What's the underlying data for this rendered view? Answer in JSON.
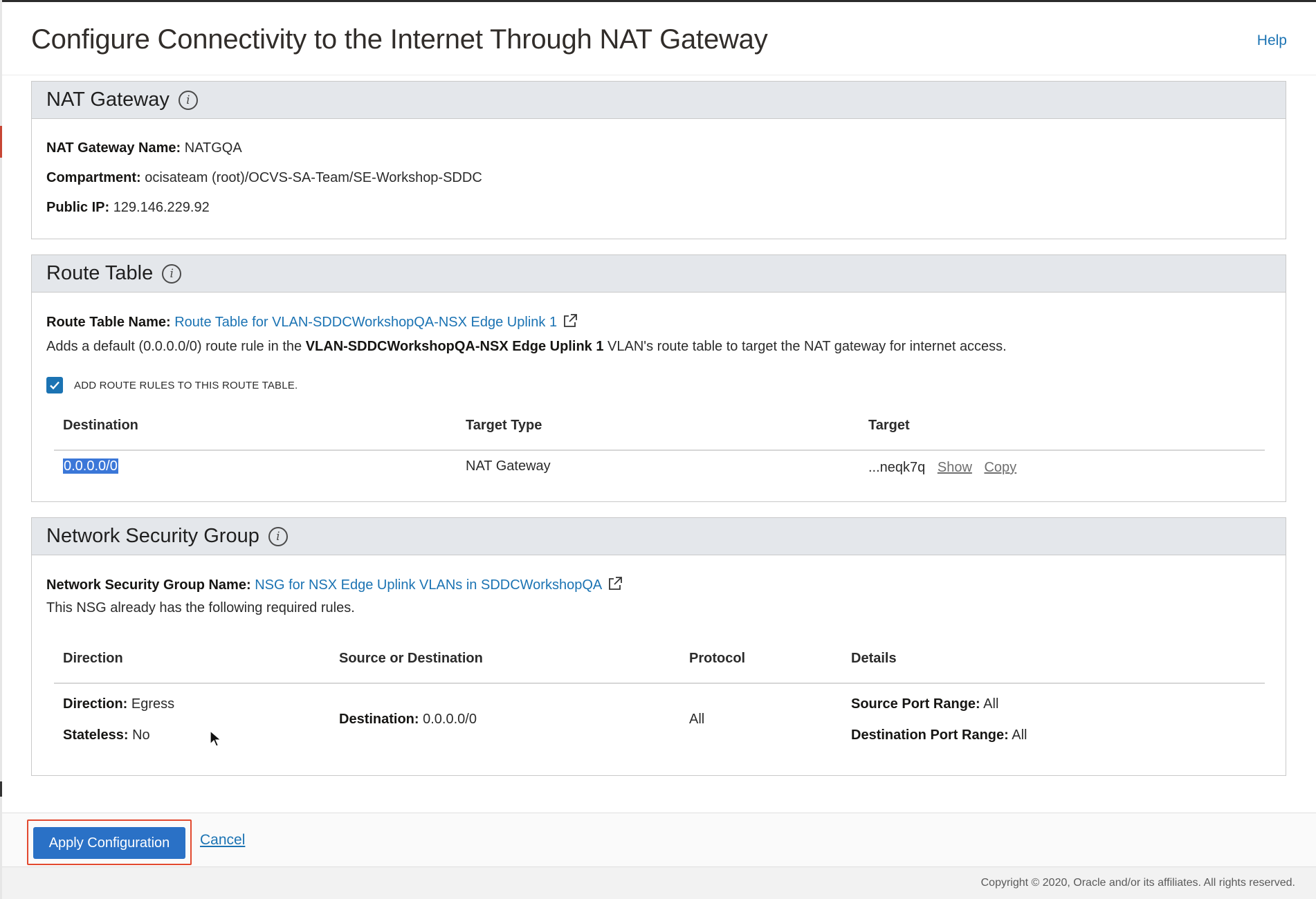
{
  "page": {
    "title": "Configure Connectivity to the Internet Through NAT Gateway",
    "help_label": "Help"
  },
  "nat_gateway": {
    "heading": "NAT Gateway",
    "info_icon": "info-icon",
    "name_label": "NAT Gateway Name:",
    "name_value": "NATGQA",
    "compartment_label": "Compartment:",
    "compartment_value": "ocisateam (root)/OCVS-SA-Team/SE-Workshop-SDDC",
    "public_ip_label": "Public IP:",
    "public_ip_value": "129.146.229.92"
  },
  "route_table": {
    "heading": "Route Table",
    "name_label": "Route Table Name:",
    "name_link": "Route Table for VLAN-SDDCWorkshopQA-NSX Edge Uplink 1",
    "external_icon": "external-link-icon",
    "desc_prefix": "Adds a default (0.0.0.0/0) route rule in the",
    "desc_vlan": "VLAN-SDDCWorkshopQA-NSX Edge Uplink 1",
    "desc_suffix": "VLAN's route table to target the NAT gateway for internet access.",
    "checkbox_label": "ADD ROUTE RULES TO THIS ROUTE TABLE.",
    "checkbox_checked": true,
    "columns": [
      "Destination",
      "Target Type",
      "Target"
    ],
    "rows": [
      {
        "destination": "0.0.0.0/0",
        "target_type": "NAT Gateway",
        "target": "...neqk7q",
        "show_label": "Show",
        "copy_label": "Copy"
      }
    ]
  },
  "nsg": {
    "heading": "Network Security Group",
    "name_label": "Network Security Group Name:",
    "name_link": "NSG for NSX Edge Uplink VLANs in SDDCWorkshopQA",
    "note": "This NSG already has the following required rules.",
    "columns": [
      "Direction",
      "Source or Destination",
      "Protocol",
      "Details"
    ],
    "rows": [
      {
        "direction_label": "Direction:",
        "direction_value": "Egress",
        "stateless_label": "Stateless:",
        "stateless_value": "No",
        "dest_label": "Destination:",
        "dest_value": "0.0.0.0/0",
        "protocol": "All",
        "src_port_label": "Source Port Range:",
        "src_port_value": "All",
        "dst_port_label": "Destination Port Range:",
        "dst_port_value": "All"
      }
    ]
  },
  "footer": {
    "apply_label": "Apply Configuration",
    "cancel_label": "Cancel",
    "copyright": "Copyright © 2020, Oracle and/or its affiliates. All rights reserved."
  },
  "colors": {
    "accent": "#1b73b3",
    "primary_button": "#2a71c6",
    "highlight_border": "#e2492f",
    "panel_header": "#e4e7eb"
  }
}
